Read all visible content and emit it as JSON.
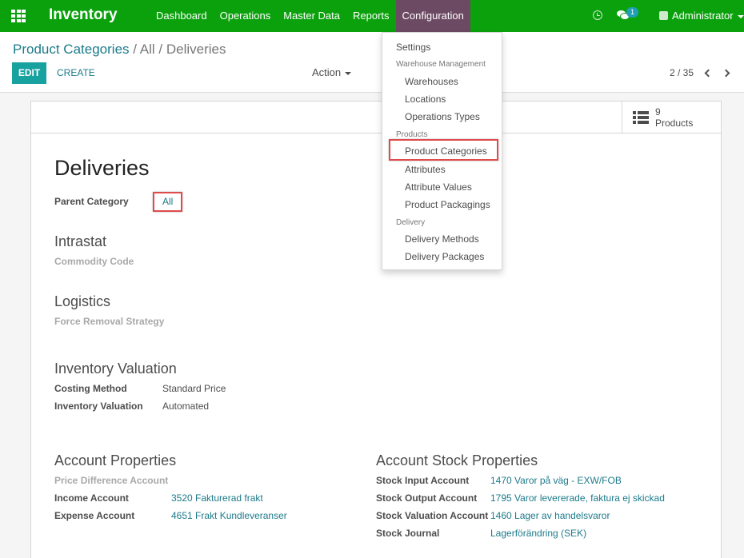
{
  "app": {
    "brand": "Inventory"
  },
  "topmenu": {
    "items": [
      {
        "label": "Dashboard"
      },
      {
        "label": "Operations"
      },
      {
        "label": "Master Data"
      },
      {
        "label": "Reports"
      },
      {
        "label": "Configuration"
      }
    ],
    "active_color": "#6d4a63"
  },
  "systray": {
    "chat_badge": "1",
    "user": "Administrator"
  },
  "breadcrumb": {
    "root": "Product Categories",
    "separator": "/",
    "current": "All / Deliveries"
  },
  "toolbar": {
    "edit": "EDIT",
    "create": "CREATE",
    "action": "Action"
  },
  "pager": {
    "value": "2 / 35"
  },
  "smart_button": {
    "count": "9",
    "label": "Products"
  },
  "form": {
    "title": "Deliveries",
    "parent_category_label": "Parent Category",
    "parent_category_value": "All",
    "intrastat": {
      "heading": "Intrastat",
      "commodity_code_label": "Commodity Code"
    },
    "logistics": {
      "heading": "Logistics",
      "force_removal_label": "Force Removal Strategy"
    },
    "valuation": {
      "heading": "Inventory Valuation",
      "costing_method_label": "Costing Method",
      "costing_method_value": "Standard Price",
      "inventory_valuation_label": "Inventory Valuation",
      "inventory_valuation_value": "Automated"
    },
    "account_properties": {
      "heading": "Account Properties",
      "price_diff_label": "Price Difference Account",
      "income_label": "Income Account",
      "income_value": "3520 Fakturerad frakt",
      "expense_label": "Expense Account",
      "expense_value": "4651 Frakt Kundleveranser"
    },
    "stock_properties": {
      "heading": "Account Stock Properties",
      "input_label": "Stock Input Account",
      "input_value": "1470 Varor på väg - EXW/FOB",
      "output_label": "Stock Output Account",
      "output_value": "1795 Varor levererade, faktura ej skickad",
      "valuation_label": "Stock Valuation Account",
      "valuation_value": "1460 Lager av handelsvaror",
      "journal_label": "Stock Journal",
      "journal_value": "Lagerförändring (SEK)"
    }
  },
  "config_menu": {
    "settings": "Settings",
    "warehouse_header": "Warehouse Management",
    "warehouses": "Warehouses",
    "locations": "Locations",
    "operation_types": "Operations Types",
    "products_header": "Products",
    "product_categories": "Product Categories",
    "attributes": "Attributes",
    "attribute_values": "Attribute Values",
    "product_packagings": "Product Packagings",
    "delivery_header": "Delivery",
    "delivery_methods": "Delivery Methods",
    "delivery_packages": "Delivery Packages"
  },
  "colors": {
    "navbar": "#0ba10d",
    "primary": "#17a2a0",
    "link": "#1c7a8a",
    "highlight": "#e04b4b"
  }
}
